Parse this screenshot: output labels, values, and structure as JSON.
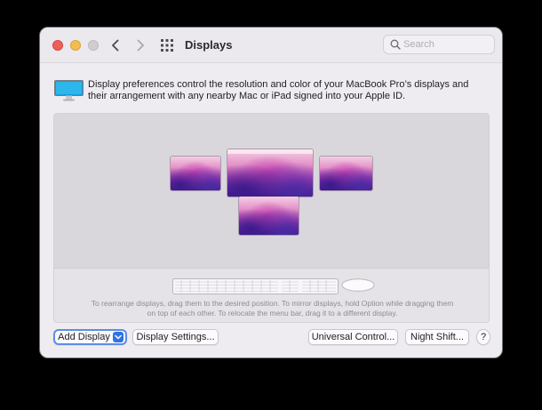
{
  "window": {
    "title": "Displays",
    "search_placeholder": "Search"
  },
  "description": "Display preferences control the resolution and color of your MacBook Pro’s displays and their arrangement with any nearby Mac or iPad signed into your Apple ID.",
  "arrangement_hint": "To rearrange displays, drag them to the desired position. To mirror displays, hold Option while dragging them on top of each other. To relocate the menu bar, drag it to a different display.",
  "buttons": {
    "add_display": "Add Display",
    "display_settings": "Display Settings...",
    "universal_control": "Universal Control...",
    "night_shift": "Night Shift...",
    "help": "?"
  },
  "icons": {
    "back": "chevron-left-icon",
    "forward": "chevron-right-icon",
    "show_all": "grid-icon",
    "search": "magnifier-icon",
    "pane": "display-icon",
    "dropdown": "chevron-down-icon"
  },
  "colors": {
    "accent": "#2f72e6",
    "traffic_red": "#ed5f57",
    "traffic_yellow": "#f4bd4f"
  }
}
